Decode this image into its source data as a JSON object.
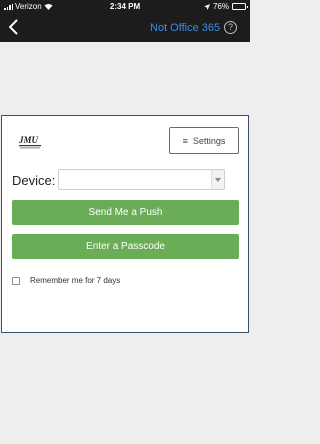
{
  "status_bar": {
    "carrier": "Verizon",
    "time": "2:34 PM",
    "battery": "76%",
    "battery_level": 0.76,
    "icons": [
      "signal-icon",
      "wifi-icon",
      "battery-icon"
    ]
  },
  "nav": {
    "back_icon": "chevron-left-icon",
    "not_office": "Not Office 365",
    "help_label": "?"
  },
  "card": {
    "settings_label": "Settings",
    "settings_icon": "menu-icon",
    "device_label": "Device:",
    "device_value": "",
    "push_label": "Send Me a Push",
    "passcode_label": "Enter a Passcode",
    "remember_label": "Remember me for 7 days",
    "remember_checked": false
  },
  "colors": {
    "bar_bg": "#1c1c1c",
    "link_blue": "#3a8ee6",
    "button_green": "#6aad56",
    "page_bg": "#eeeeee"
  }
}
